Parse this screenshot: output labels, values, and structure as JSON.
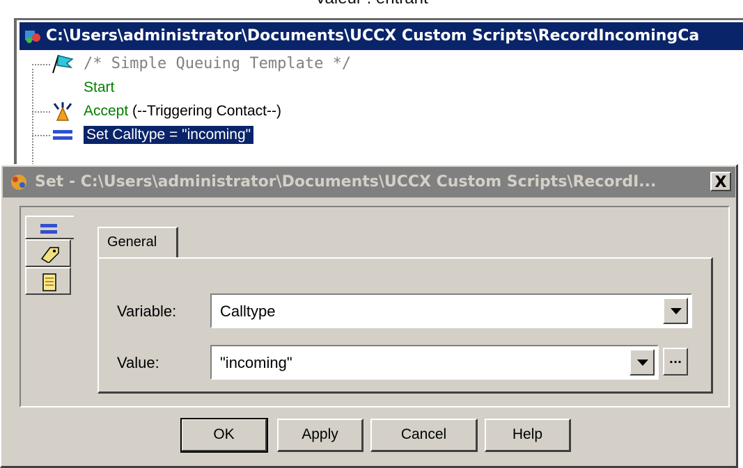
{
  "caption": "Valeur : entrant",
  "editor": {
    "title": "C:\\Users\\administrator\\Documents\\UCCX Custom Scripts\\RecordIncomingCa",
    "tree": [
      {
        "label": "/* Simple Queuing Template */",
        "icon": "flag-icon"
      },
      {
        "label": "Start",
        "icon": ""
      },
      {
        "label_step": "Accept",
        "label_rest": " (--Triggering Contact--)",
        "icon": "accept-icon"
      },
      {
        "label": "Set Calltype = \"incoming\"",
        "icon": "set-icon",
        "selected": true
      }
    ]
  },
  "dialog": {
    "title": "Set - C:\\Users\\administrator\\Documents\\UCCX Custom Scripts\\RecordI...",
    "close_label": "X",
    "tab_general": "General",
    "variable_label": "Variable:",
    "variable_value": "Calltype",
    "value_label": "Value:",
    "value_value": "\"incoming\"",
    "ellipsis_label": "...",
    "buttons": {
      "ok": "OK",
      "apply": "Apply",
      "cancel": "Cancel",
      "help": "Help"
    }
  },
  "colors": {
    "title_active": "#0a246a",
    "title_inactive": "#808080",
    "face": "#d4d0c8",
    "step_green": "#008000"
  }
}
